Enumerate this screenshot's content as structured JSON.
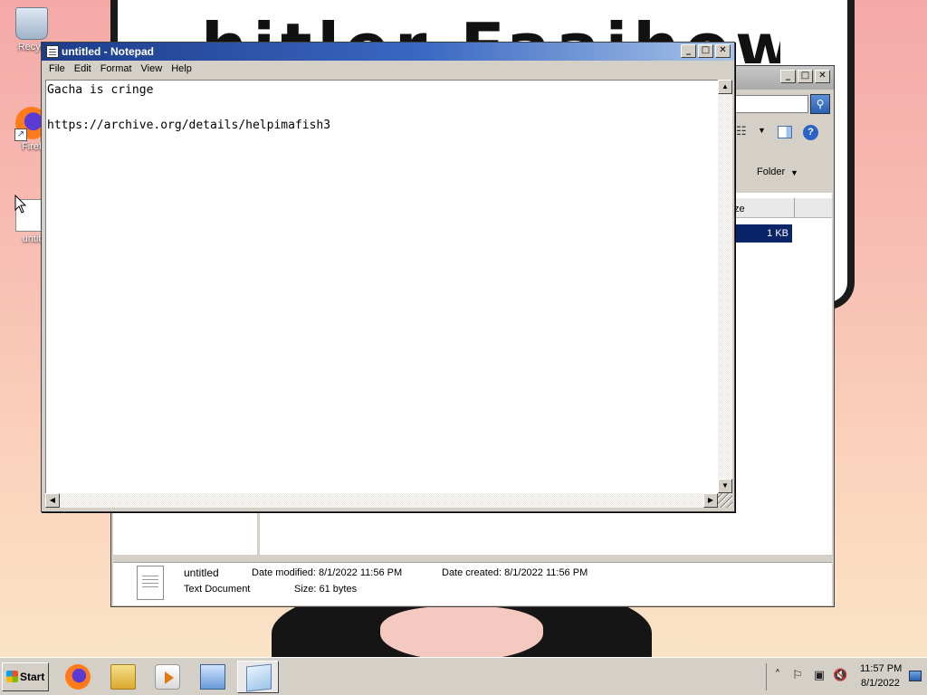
{
  "wallpaper": {
    "text": "hitler Faaihowed"
  },
  "desktop": {
    "icons": [
      {
        "label": "Recycle Bin",
        "visible_label": "Recyc",
        "icon": "recycle-bin-icon"
      },
      {
        "label": "Firefox",
        "visible_label": "Firef",
        "icon": "firefox-icon"
      },
      {
        "label": "untitled",
        "visible_label": "untit",
        "icon": "text-file-icon"
      }
    ]
  },
  "notepad": {
    "title": "untitled - Notepad",
    "menu": [
      "File",
      "Edit",
      "Format",
      "View",
      "Help"
    ],
    "content": "Gacha is cringe\n\nhttps://archive.org/details/helpimafish3",
    "buttons": {
      "minimize": "_",
      "maximize": "□",
      "close": "✕"
    }
  },
  "explorer": {
    "arrange_label": "y:",
    "arrange_value": "Folder",
    "column_header": "ze",
    "selected_file_size": "1 KB",
    "details": {
      "name": "untitled",
      "type": "Text Document",
      "date_modified": "Date modified: 8/1/2022 11:56 PM",
      "date_created": "Date created: 8/1/2022 11:56 PM",
      "size": "Size: 61 bytes"
    }
  },
  "taskbar": {
    "start_label": "Start",
    "pinned": [
      {
        "name": "firefox",
        "icon": "firefox-icon"
      },
      {
        "name": "windows-explorer",
        "icon": "folder-icon"
      },
      {
        "name": "media-player",
        "icon": "media-player-icon"
      },
      {
        "name": "control-panel",
        "icon": "control-panel-icon"
      },
      {
        "name": "notepad",
        "icon": "notepad-icon",
        "active": true
      }
    ],
    "tray": {
      "time": "11:57 PM",
      "date": "8/1/2022"
    }
  }
}
